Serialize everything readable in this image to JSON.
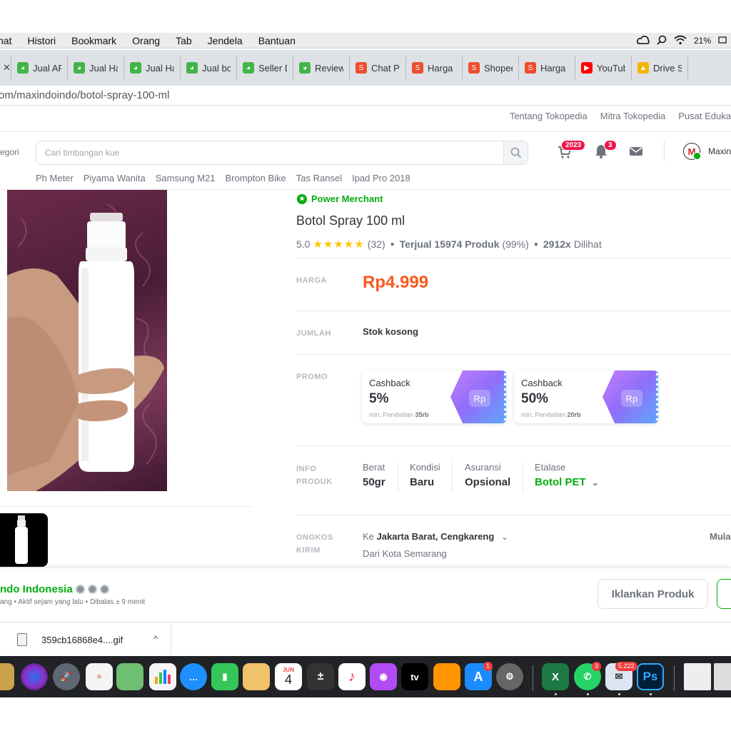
{
  "menubar": {
    "items": [
      "hat",
      "Histori",
      "Bookmark",
      "Orang",
      "Tab",
      "Jendela",
      "Bantuan"
    ],
    "battery": "21%"
  },
  "tabs": [
    {
      "label": "Jual AF",
      "icon": "tokopedia-icon"
    },
    {
      "label": "Jual Ha",
      "icon": "tokopedia-icon"
    },
    {
      "label": "Jual Ha",
      "icon": "tokopedia-icon"
    },
    {
      "label": "Jual bo",
      "icon": "tokopedia-icon"
    },
    {
      "label": "Seller D",
      "icon": "tokopedia-icon"
    },
    {
      "label": "Review",
      "icon": "tokopedia-icon"
    },
    {
      "label": "Chat P",
      "icon": "shopee-icon"
    },
    {
      "label": "Harga",
      "icon": "shopee-icon"
    },
    {
      "label": "Shopee",
      "icon": "shopee-icon"
    },
    {
      "label": "Harga",
      "icon": "shopee-icon"
    },
    {
      "label": "YouTub",
      "icon": "youtube-icon"
    },
    {
      "label": "Drive S",
      "icon": "drive-icon"
    }
  ],
  "address": {
    "url": "om/maxindoindo/botol-spray-100-ml"
  },
  "toplinks": [
    "Tentang Tokopedia",
    "Mitra Tokopedia",
    "Pusat Eduka"
  ],
  "header": {
    "kategori": "egori",
    "search_placeholder": "Cari timbangan kue",
    "cart_badge": "2023",
    "notif_badge": "3",
    "username": "Maxin"
  },
  "keywords": [
    "Ph Meter",
    "Piyama Wanita",
    "Samsung M21",
    "Brompton Bike",
    "Tas Ransel",
    "Ipad Pro 2018"
  ],
  "product": {
    "merchant_badge": "Power Merchant",
    "title": "Botol Spray 100 ml",
    "rating": "5.0",
    "stars": 5,
    "reviews": "(32)",
    "sold_label": "Terjual 15974 Produk",
    "sold_pct": "(99%)",
    "views_count": "2912x",
    "views_label": "Dilihat",
    "harga_label": "HARGA",
    "price": "Rp4.999",
    "jumlah_label": "JUMLAH",
    "stok": "Stok kosong",
    "promo_label": "PROMO",
    "promos": [
      {
        "title": "Cashback",
        "value": "5%",
        "min_label": "min. Pembelian",
        "min_value": "35rb"
      },
      {
        "title": "Cashback",
        "value": "50%",
        "min_label": "min. Pembelian",
        "min_value": "20rb"
      }
    ],
    "info_label_1": "INFO",
    "info_label_2": "PRODUK",
    "info": [
      {
        "label": "Berat",
        "value": "50gr"
      },
      {
        "label": "Kondisi",
        "value": "Baru"
      },
      {
        "label": "Asuransi",
        "value": "Opsional"
      },
      {
        "label": "Etalase",
        "value": "Botol PET"
      }
    ],
    "ongkos_label_1": "ONGKOS",
    "ongkos_label_2": "KIRIM",
    "ongkos_to_prefix": "Ke",
    "ongkos_to": "Jakarta Barat, Cengkareng",
    "ongkos_from": "Dari Kota Semarang",
    "ongkos_mula": "Mula"
  },
  "shop": {
    "name": "ndo Indonesia",
    "meta": "ang • Aktif sejam yang lalu • Dibalas ± 9 menit",
    "iklan_button": "Iklankan Produk"
  },
  "download": {
    "filename": "359cb16868e4....gif"
  },
  "dock": {
    "calendar_month": "JUN",
    "calendar_day": "4",
    "appstore_badge": "1",
    "whatsapp_badge": "3",
    "mail_badge": "5.222",
    "ps_label": "Ps",
    "tv_label": "tv"
  },
  "colors": {
    "tokopedia_green": "#03ac0e",
    "price_orange": "#fa591d",
    "badge_red": "#ef144a",
    "star_yellow": "#ffc400"
  }
}
